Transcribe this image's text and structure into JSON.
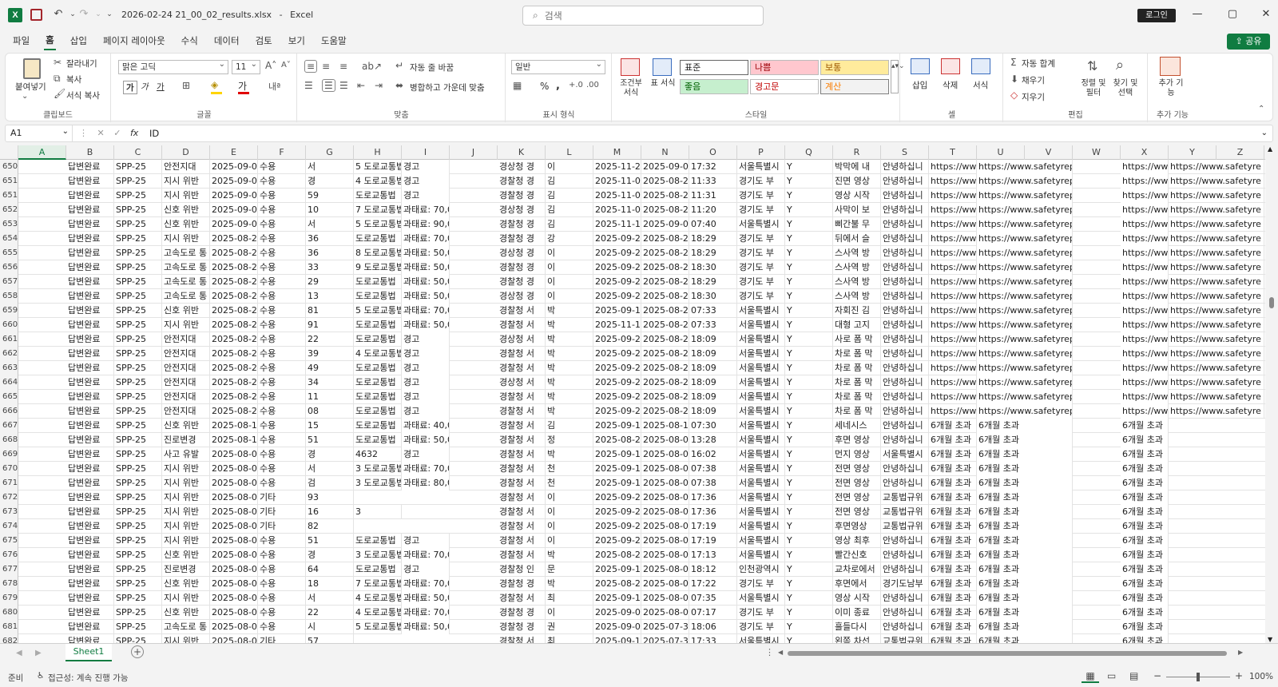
{
  "titlebar": {
    "app_icon": "excel-icon",
    "filename": "2026-02-24 21_00_02_results.xlsx",
    "app_name": "Excel",
    "search_placeholder": "검색",
    "signin": "로그인"
  },
  "menu": [
    "파일",
    "홈",
    "삽입",
    "페이지 레이아웃",
    "수식",
    "데이터",
    "검토",
    "보기",
    "도움말"
  ],
  "share": "공유",
  "ribbon": {
    "clipboard": {
      "paste": "붙여넣기",
      "cut": "잘라내기",
      "copy": "복사",
      "format_painter": "서식 복사",
      "label": "클립보드"
    },
    "font": {
      "name": "맑은 고딕",
      "size": "11",
      "bold": "가",
      "italic": "가",
      "underline": "가",
      "label": "글꼴"
    },
    "alignment": {
      "wrap": "자동 줄 바꿈",
      "merge": "병합하고 가운데 맞춤",
      "label": "맞춤"
    },
    "number": {
      "format": "일반",
      "percent": "%",
      "comma": ",",
      "label": "표시 형식"
    },
    "styles": {
      "conditional": "조건부 서식",
      "table": "표 서식",
      "normal": "표준",
      "bad": "나쁨",
      "neutral": "보통",
      "good": "좋음",
      "warning": "경고문",
      "calc": "계산",
      "label": "스타일"
    },
    "cells": {
      "insert": "삽입",
      "delete": "삭제",
      "format": "서식",
      "label": "셀"
    },
    "editing": {
      "autosum": "자동 합계",
      "fill": "채우기",
      "clear": "지우기",
      "sort": "정렬 및 필터",
      "find": "찾기 및 선택",
      "label": "편집"
    },
    "addins": {
      "addin": "추가 기능",
      "label": "추가 기능"
    }
  },
  "formula_bar": {
    "name_box": "A1",
    "fx": "fx",
    "content": "ID"
  },
  "columns": [
    "A",
    "B",
    "C",
    "D",
    "E",
    "F",
    "G",
    "H",
    "I",
    "J",
    "K",
    "L",
    "M",
    "N",
    "O",
    "P",
    "Q",
    "R",
    "S",
    "T",
    "U",
    "V",
    "W",
    "X",
    "Y",
    "Z"
  ],
  "rows": [
    {
      "n": "650",
      "B": "답변완료",
      "C": "SPP-25",
      "D": "안전지대",
      "E": "2025-09-0",
      "F": "수용",
      "G": "서",
      "H": "5 도로교통법",
      "I": "경고",
      "K": "경상청 경",
      "L": "이",
      "M": "2025-11-2",
      "N": "2025-09-0",
      "O": "17:32",
      "P": "서울특별시",
      "Q": "Y",
      "R": "박막에 내",
      "S": "안녕하십니",
      "T": "https://ww",
      "U": "https://www.safetyreport.go.kr/f",
      "X": "https://ww",
      "Y": "https://www.safetyre"
    },
    {
      "n": "651",
      "B": "답변완료",
      "C": "SPP-25",
      "D": "지시 위반",
      "E": "2025-09-0",
      "F": "수용",
      "G": "경",
      "H": "4 도로교통법",
      "I": "경고",
      "K": "경찰청 경",
      "L": "김",
      "M": "2025-11-0",
      "N": "2025-08-2",
      "O": "11:33",
      "P": "경기도 부",
      "Q": "Y",
      "R": "진면 영상",
      "S": "안녕하십니",
      "T": "https://ww",
      "U": "https://www.safetyreport.go.kr/f",
      "X": "https://ww",
      "Y": "https://www.safetyre"
    },
    {
      "n": "651",
      "B": "답변완료",
      "C": "SPP-25",
      "D": "지시 위반",
      "E": "2025-09-0",
      "F": "수용",
      "G": "59",
      "H": "도로교통법",
      "I": "경고",
      "K": "경찰청 경",
      "L": "김",
      "M": "2025-11-0",
      "N": "2025-08-2",
      "O": "11:31",
      "P": "경기도 부",
      "Q": "Y",
      "R": "영상 시작",
      "S": "안녕하십니",
      "T": "https://ww",
      "U": "https://www.safetyreport.go.kr/f",
      "X": "https://ww",
      "Y": "https://www.safetyre"
    },
    {
      "n": "652",
      "B": "답변완료",
      "C": "SPP-25",
      "D": "신호 위반",
      "E": "2025-09-0",
      "F": "수용",
      "G": "10",
      "H": "7 도로교통법",
      "I": "과태료: 70,000원",
      "K": "경상청 경",
      "L": "김",
      "M": "2025-11-0",
      "N": "2025-08-2",
      "O": "11:20",
      "P": "경기도 부",
      "Q": "Y",
      "R": "사막이 보",
      "S": "안녕하십니",
      "T": "https://ww",
      "U": "https://www.safetyreport.go.kr/f",
      "X": "https://ww",
      "Y": "https://www.safetyre"
    },
    {
      "n": "653",
      "B": "답변완료",
      "C": "SPP-25",
      "D": "신호 위반",
      "E": "2025-09-0",
      "F": "수용",
      "G": "서",
      "H": "5 도로교통법",
      "I": "과태료: 90,000원",
      "K": "경찰청 경",
      "L": "김",
      "M": "2025-11-1",
      "N": "2025-09-0",
      "O": "07:40",
      "P": "서울특별시",
      "Q": "Y",
      "R": "삐간불 무",
      "S": "안녕하십니",
      "T": "https://ww",
      "U": "https://www.safetyreport.go.kr/f",
      "X": "https://ww",
      "Y": "https://www.safetyre"
    },
    {
      "n": "654",
      "B": "답변완료",
      "C": "SPP-25",
      "D": "지시 위반",
      "E": "2025-08-2",
      "F": "수용",
      "G": "36",
      "H": "도로교통법",
      "I": "과태료: 70,000원",
      "K": "경찰청 경",
      "L": "강",
      "M": "2025-09-2",
      "N": "2025-08-2",
      "O": "18:29",
      "P": "경기도 부",
      "Q": "Y",
      "R": "뒤에서 슬",
      "S": "안녕하십니",
      "T": "https://ww",
      "U": "https://www.safetyreport.go.kr/f",
      "X": "https://ww",
      "Y": "https://www.safetyre"
    },
    {
      "n": "655",
      "B": "답변완료",
      "C": "SPP-25",
      "D": "고속도로 통",
      "E": "2025-08-2",
      "F": "수용",
      "G": "36",
      "H": "8 도로교통법",
      "I": "과태료: 50,000원",
      "K": "경상청 경",
      "L": "이",
      "M": "2025-09-2",
      "N": "2025-08-2",
      "O": "18:29",
      "P": "경기도 부",
      "Q": "Y",
      "R": "스사역 방",
      "S": "안녕하십니",
      "T": "https://ww",
      "U": "https://www.safetyreport.go.kr/f",
      "X": "https://ww",
      "Y": "https://www.safetyre"
    },
    {
      "n": "656",
      "B": "답변완료",
      "C": "SPP-25",
      "D": "고속도로 통",
      "E": "2025-08-2",
      "F": "수용",
      "G": "33",
      "H": "9 도로교통법",
      "I": "과태료: 50,000원",
      "K": "경찰청 경",
      "L": "이",
      "M": "2025-09-2",
      "N": "2025-08-2",
      "O": "18:30",
      "P": "경기도 부",
      "Q": "Y",
      "R": "스사역 방",
      "S": "안녕하십니",
      "T": "https://ww",
      "U": "https://www.safetyreport.go.kr/f",
      "X": "https://ww",
      "Y": "https://www.safetyre"
    },
    {
      "n": "657",
      "B": "답변완료",
      "C": "SPP-25",
      "D": "고속도로 통",
      "E": "2025-08-2",
      "F": "수용",
      "G": "29",
      "H": "도로교통법",
      "I": "과태료: 50,000원",
      "K": "경찰청 경",
      "L": "이",
      "M": "2025-09-2",
      "N": "2025-08-2",
      "O": "18:29",
      "P": "경기도 부",
      "Q": "Y",
      "R": "스사역 방",
      "S": "안녕하십니",
      "T": "https://ww",
      "U": "https://www.safetyreport.go.kr/f",
      "X": "https://ww",
      "Y": "https://www.safetyre"
    },
    {
      "n": "658",
      "B": "답변완료",
      "C": "SPP-25",
      "D": "고속도로 통",
      "E": "2025-08-2",
      "F": "수용",
      "G": "13",
      "H": "도로교통법",
      "I": "과태료: 50,000원",
      "K": "경상청 경",
      "L": "이",
      "M": "2025-09-2",
      "N": "2025-08-2",
      "O": "18:30",
      "P": "경기도 부",
      "Q": "Y",
      "R": "스사역 방",
      "S": "안녕하십니",
      "T": "https://ww",
      "U": "https://www.safetyreport.go.kr/f",
      "X": "https://ww",
      "Y": "https://www.safetyre"
    },
    {
      "n": "659",
      "B": "답변완료",
      "C": "SPP-25",
      "D": "신호 위반",
      "E": "2025-08-2",
      "F": "수용",
      "G": "81",
      "H": "5 도로교통법",
      "I": "과태료: 70,000원",
      "K": "경찰청 서",
      "L": "박",
      "M": "2025-09-1",
      "N": "2025-08-2",
      "O": "07:33",
      "P": "서울특별시",
      "Q": "Y",
      "R": "자회진 김",
      "S": "안녕하십니",
      "T": "https://ww",
      "U": "https://www.safetyreport.go.kr/f",
      "X": "https://ww",
      "Y": "https://www.safetyre"
    },
    {
      "n": "660",
      "B": "답변완료",
      "C": "SPP-25",
      "D": "지시 위반",
      "E": "2025-08-2",
      "F": "수용",
      "G": "91",
      "H": "도로교통법",
      "I": "과태료: 50,000원",
      "K": "경찰청 서",
      "L": "박",
      "M": "2025-11-1",
      "N": "2025-08-2",
      "O": "07:33",
      "P": "서울특별시",
      "Q": "Y",
      "R": "대형 고지",
      "S": "안녕하십니",
      "T": "https://ww",
      "U": "https://www.safetyreport.go.kr/f",
      "X": "https://ww",
      "Y": "https://www.safetyre"
    },
    {
      "n": "661",
      "B": "답변완료",
      "C": "SPP-25",
      "D": "안전지대",
      "E": "2025-08-2",
      "F": "수용",
      "G": "22",
      "H": "도로교통법",
      "I": "경고",
      "K": "경상청 서",
      "L": "박",
      "M": "2025-09-2",
      "N": "2025-08-2",
      "O": "18:09",
      "P": "서울특별시",
      "Q": "Y",
      "R": "사로 폼 막",
      "S": "안녕하십니",
      "T": "https://ww",
      "U": "https://www.safetyreport.go.kr/f",
      "X": "https://ww",
      "Y": "https://www.safetyre"
    },
    {
      "n": "662",
      "B": "답변완료",
      "C": "SPP-25",
      "D": "안전지대",
      "E": "2025-08-2",
      "F": "수용",
      "G": "39",
      "H": "4 도로교통법",
      "I": "경고",
      "K": "경찰청 서",
      "L": "박",
      "M": "2025-09-2",
      "N": "2025-08-2",
      "O": "18:09",
      "P": "서울특별시",
      "Q": "Y",
      "R": "차로 폼 막",
      "S": "안녕하십니",
      "T": "https://ww",
      "U": "https://www.safetyreport.go.kr/f",
      "X": "https://ww",
      "Y": "https://www.safetyre"
    },
    {
      "n": "663",
      "B": "답변완료",
      "C": "SPP-25",
      "D": "안전지대",
      "E": "2025-08-2",
      "F": "수용",
      "G": "49",
      "H": "도로교통법",
      "I": "경고",
      "K": "경찰청 서",
      "L": "박",
      "M": "2025-09-2",
      "N": "2025-08-2",
      "O": "18:09",
      "P": "서울특별시",
      "Q": "Y",
      "R": "차로 폼 막",
      "S": "안녕하십니",
      "T": "https://ww",
      "U": "https://www.safetyreport.go.kr/f",
      "X": "https://ww",
      "Y": "https://www.safetyre"
    },
    {
      "n": "664",
      "B": "답변완료",
      "C": "SPP-25",
      "D": "안전지대",
      "E": "2025-08-2",
      "F": "수용",
      "G": "34",
      "H": "도로교통법",
      "I": "경고",
      "K": "경상청 서",
      "L": "박",
      "M": "2025-09-2",
      "N": "2025-08-2",
      "O": "18:09",
      "P": "서울특별시",
      "Q": "Y",
      "R": "차로 폼 막",
      "S": "안녕하십니",
      "T": "https://ww",
      "U": "https://www.safetyreport.go.kr/f",
      "X": "https://ww",
      "Y": "https://www.safetyre"
    },
    {
      "n": "665",
      "B": "답변완료",
      "C": "SPP-25",
      "D": "안전지대",
      "E": "2025-08-2",
      "F": "수용",
      "G": "11",
      "H": "도로교통법",
      "I": "경고",
      "K": "경찰청 서",
      "L": "박",
      "M": "2025-09-2",
      "N": "2025-08-2",
      "O": "18:09",
      "P": "서울특별시",
      "Q": "Y",
      "R": "차로 폼 막",
      "S": "안녕하십니",
      "T": "https://ww",
      "U": "https://www.safetyreport.go.kr/f",
      "X": "https://ww",
      "Y": "https://www.safetyre"
    },
    {
      "n": "666",
      "B": "답변완료",
      "C": "SPP-25",
      "D": "안전지대",
      "E": "2025-08-2",
      "F": "수용",
      "G": "08",
      "H": "도로교통법",
      "I": "경고",
      "K": "경찰청 서",
      "L": "박",
      "M": "2025-09-2",
      "N": "2025-08-2",
      "O": "18:09",
      "P": "서울특별시",
      "Q": "Y",
      "R": "차로 폼 막",
      "S": "안녕하십니",
      "T": "https://ww",
      "U": "https://www.safetyreport.go.kr/f",
      "X": "https://ww",
      "Y": "https://www.safetyre"
    },
    {
      "n": "667",
      "B": "답변완료",
      "C": "SPP-25",
      "D": "신호 위반",
      "E": "2025-08-1",
      "F": "수용",
      "G": "15",
      "H": "도로교통법",
      "I": "과태료: 40,000원",
      "K": "경찰청 서",
      "L": "김",
      "M": "2025-09-1",
      "N": "2025-08-1",
      "O": "07:30",
      "P": "서울특별시",
      "Q": "Y",
      "R": "세네시스",
      "S": "안녕하십니",
      "T": "6개월 초과",
      "U": "6개월 초과",
      "X": "6개월 초과"
    },
    {
      "n": "668",
      "B": "답변완료",
      "C": "SPP-25",
      "D": "진로변경",
      "E": "2025-08-1",
      "F": "수용",
      "G": "51",
      "H": "도로교통법",
      "I": "과태료: 50,000원",
      "K": "경찰청 서",
      "L": "정",
      "M": "2025-08-2",
      "N": "2025-08-0",
      "O": "13:28",
      "P": "서울특별시",
      "Q": "Y",
      "R": "후면 영상",
      "S": "안녕하십니",
      "T": "6개월 초과",
      "U": "6개월 초과",
      "X": "6개월 초과"
    },
    {
      "n": "669",
      "B": "답변완료",
      "C": "SPP-25",
      "D": "사고 유발",
      "E": "2025-08-0",
      "F": "수용",
      "G": "경",
      "H": "4632",
      "I": "경고",
      "K": "경찰청 서",
      "L": "박",
      "M": "2025-09-1",
      "N": "2025-08-0",
      "O": "16:02",
      "P": "서울특별시",
      "Q": "Y",
      "R": "먼지 영상",
      "S": "서울특별시",
      "T": "6개월 초과",
      "U": "6개월 초과",
      "X": "6개월 초과"
    },
    {
      "n": "670",
      "B": "답변완료",
      "C": "SPP-25",
      "D": "지시 위반",
      "E": "2025-08-0",
      "F": "수용",
      "G": "서",
      "H": "3 도로교통법",
      "I": "과태료: 70,000원",
      "K": "경찰청 서",
      "L": "천",
      "M": "2025-09-1",
      "N": "2025-08-0",
      "O": "07:38",
      "P": "서울특별시",
      "Q": "Y",
      "R": "전면 영상",
      "S": "안녕하십니",
      "T": "6개월 초과",
      "U": "6개월 초과",
      "X": "6개월 초과"
    },
    {
      "n": "671",
      "B": "답변완료",
      "C": "SPP-25",
      "D": "지시 위반",
      "E": "2025-08-0",
      "F": "수용",
      "G": "검",
      "H": "3 도로교통법",
      "I": "과태료: 80,000원",
      "K": "경찰청 서",
      "L": "천",
      "M": "2025-09-1",
      "N": "2025-08-0",
      "O": "07:38",
      "P": "서울특별시",
      "Q": "Y",
      "R": "전면 영상",
      "S": "안녕하십니",
      "T": "6개월 초과",
      "U": "6개월 초과",
      "X": "6개월 초과"
    },
    {
      "n": "672",
      "B": "답변완료",
      "C": "SPP-25",
      "D": "지시 위반",
      "E": "2025-08-0",
      "F": "기타",
      "G": "93",
      "K": "경찰청 서",
      "L": "이",
      "M": "2025-09-2",
      "N": "2025-08-0",
      "O": "17:36",
      "P": "서울특별시",
      "Q": "Y",
      "R": "전면 영상",
      "S": "교통법규위",
      "T": "6개월 초과",
      "U": "6개월 초과",
      "X": "6개월 초과"
    },
    {
      "n": "673",
      "B": "답변완료",
      "C": "SPP-25",
      "D": "지시 위반",
      "E": "2025-08-0",
      "F": "기타",
      "G": "16",
      "H": "3",
      "K": "경찰청 서",
      "L": "이",
      "M": "2025-09-2",
      "N": "2025-08-0",
      "O": "17:36",
      "P": "서울특별시",
      "Q": "Y",
      "R": "전면 영상",
      "S": "교통법규위",
      "T": "6개월 초과",
      "U": "6개월 초과",
      "X": "6개월 초과"
    },
    {
      "n": "674",
      "B": "답변완료",
      "C": "SPP-25",
      "D": "지시 위반",
      "E": "2025-08-0",
      "F": "기타",
      "G": "82",
      "K": "경찰청 서",
      "L": "이",
      "M": "2025-09-2",
      "N": "2025-08-0",
      "O": "17:19",
      "P": "서울특별시",
      "Q": "Y",
      "R": "후면영상",
      "S": "교통법규위",
      "T": "6개월 초과",
      "U": "6개월 초과",
      "X": "6개월 초과"
    },
    {
      "n": "675",
      "B": "답변완료",
      "C": "SPP-25",
      "D": "지시 위반",
      "E": "2025-08-0",
      "F": "수용",
      "G": "51",
      "H": "도로교통법",
      "I": "경고",
      "K": "경찰청 서",
      "L": "이",
      "M": "2025-09-2",
      "N": "2025-08-0",
      "O": "17:19",
      "P": "서울특별시",
      "Q": "Y",
      "R": "영상 최후",
      "S": "안녕하십니",
      "T": "6개월 초과",
      "U": "6개월 초과",
      "X": "6개월 초과"
    },
    {
      "n": "676",
      "B": "답변완료",
      "C": "SPP-25",
      "D": "신호 위반",
      "E": "2025-08-0",
      "F": "수용",
      "G": "경",
      "H": "3 도로교통법",
      "I": "과태료: 70,000원",
      "K": "경찰청 서",
      "L": "박",
      "M": "2025-08-2",
      "N": "2025-08-0",
      "O": "17:13",
      "P": "서울특별시",
      "Q": "Y",
      "R": "빨간신호",
      "S": "안녕하십니",
      "T": "6개월 초과",
      "U": "6개월 초과",
      "X": "6개월 초과"
    },
    {
      "n": "677",
      "B": "답변완료",
      "C": "SPP-25",
      "D": "진로변경",
      "E": "2025-08-0",
      "F": "수용",
      "G": "64",
      "H": "도로교통법",
      "I": "경고",
      "K": "경찰청 인",
      "L": "문",
      "M": "2025-09-1",
      "N": "2025-08-0",
      "O": "18:12",
      "P": "인천광역시",
      "Q": "Y",
      "R": "교차로에서",
      "S": "안녕하십니",
      "T": "6개월 초과",
      "U": "6개월 초과",
      "X": "6개월 초과"
    },
    {
      "n": "678",
      "B": "답변완료",
      "C": "SPP-25",
      "D": "신호 위반",
      "E": "2025-08-0",
      "F": "수용",
      "G": "18",
      "H": "7 도로교통법",
      "I": "과태료: 70,000원",
      "K": "경찰청 경",
      "L": "박",
      "M": "2025-08-2",
      "N": "2025-08-0",
      "O": "17:22",
      "P": "경기도 부",
      "Q": "Y",
      "R": "후면에서",
      "S": "경기도남부",
      "T": "6개월 초과",
      "U": "6개월 초과",
      "X": "6개월 초과"
    },
    {
      "n": "679",
      "B": "답변완료",
      "C": "SPP-25",
      "D": "지시 위반",
      "E": "2025-08-0",
      "F": "수용",
      "G": "서",
      "H": "4 도로교통법",
      "I": "과태료: 50,000원",
      "K": "경찰청 서",
      "L": "최",
      "M": "2025-09-1",
      "N": "2025-08-0",
      "O": "07:35",
      "P": "서울특별시",
      "Q": "Y",
      "R": "영상 시작",
      "S": "안녕하십니",
      "T": "6개월 초과",
      "U": "6개월 초과",
      "X": "6개월 초과"
    },
    {
      "n": "680",
      "B": "답변완료",
      "C": "SPP-25",
      "D": "신호 위반",
      "E": "2025-08-0",
      "F": "수용",
      "G": "22",
      "H": "4 도로교통법",
      "I": "과태료: 70,000원",
      "K": "경찰청 경",
      "L": "이",
      "M": "2025-09-0",
      "N": "2025-08-0",
      "O": "07:17",
      "P": "경기도 부",
      "Q": "Y",
      "R": "이미 종료",
      "S": "안녕하십니",
      "T": "6개월 초과",
      "U": "6개월 초과",
      "X": "6개월 초과"
    },
    {
      "n": "681",
      "B": "답변완료",
      "C": "SPP-25",
      "D": "고속도로 통",
      "E": "2025-08-0",
      "F": "수용",
      "G": "시",
      "H": "5 도로교통법",
      "I": "과태료: 50,000원",
      "K": "경찰청 경",
      "L": "권",
      "M": "2025-09-0",
      "N": "2025-07-3",
      "O": "18:06",
      "P": "경기도 부",
      "Q": "Y",
      "R": "흘들다시",
      "S": "안녕하십니",
      "T": "6개월 초과",
      "U": "6개월 초과",
      "X": "6개월 초과"
    },
    {
      "n": "682",
      "B": "답변완료",
      "C": "SPP-25",
      "D": "지시 위반",
      "E": "2025-08-0",
      "F": "기타",
      "G": "57",
      "K": "경찰청 서",
      "L": "최",
      "M": "2025-09-1",
      "N": "2025-07-3",
      "O": "17:33",
      "P": "서울특별시",
      "Q": "Y",
      "R": "왼쪽 차선",
      "S": "교통법규위",
      "T": "6개월 초과",
      "U": "6개월 초과",
      "X": "6개월 초과"
    }
  ],
  "sheet_tab": "Sheet1",
  "status": {
    "ready": "준비",
    "accessibility": "접근성: 계속 진행 가능",
    "zoom": "100%"
  }
}
